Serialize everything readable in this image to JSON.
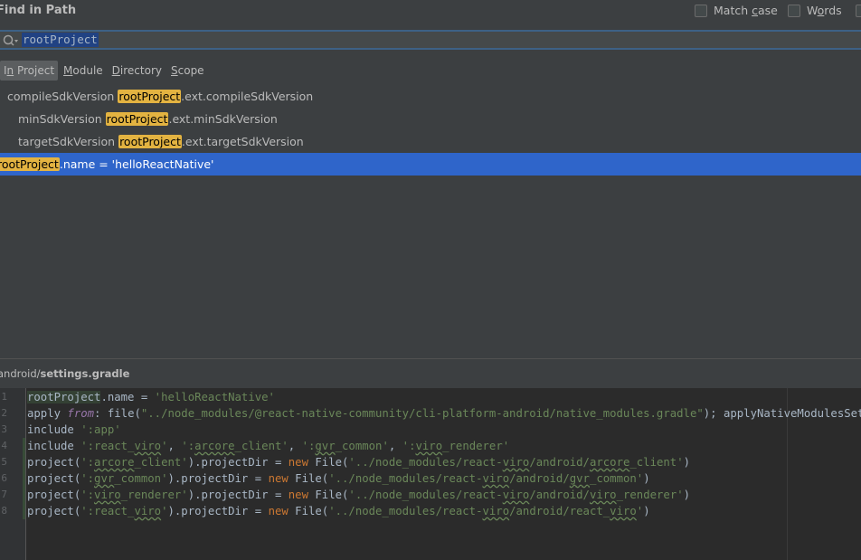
{
  "header": {
    "title": "Find in Path",
    "match_case_label": "Match case",
    "words_label": "Words"
  },
  "search": {
    "value": "rootProject"
  },
  "scopes": [
    "In Project",
    "Module",
    "Directory",
    "Scope"
  ],
  "results": [
    {
      "before": "compileSdkVersion ",
      "match": "rootProject",
      "after": ".ext.compileSdkVersion"
    },
    {
      "before": "minSdkVersion ",
      "match": "rootProject",
      "after": ".ext.minSdkVersion"
    },
    {
      "before": "targetSdkVersion ",
      "match": "rootProject",
      "after": ".ext.targetSdkVersion"
    },
    {
      "before": "",
      "match": "rootProject",
      "after": ".name = 'helloReactNative'"
    }
  ],
  "file": {
    "dir": "android/",
    "name": "settings.gradle"
  },
  "editor": {
    "line_numbers": [
      "1",
      "2",
      "3",
      "4",
      "5",
      "6",
      "7",
      "8"
    ],
    "lines": [
      "rootProject.name = 'helloReactNative'",
      "apply from: file(\"../node_modules/@react-native-community/cli-platform-android/native_modules.gradle\"); applyNativeModulesSettingsGr",
      "include ':app'",
      "include ':react_viro', ':arcore_client', ':gvr_common', ':viro_renderer'",
      "project(':arcore_client').projectDir = new File('../node_modules/react-viro/android/arcore_client')",
      "project(':gvr_common').projectDir = new File('../node_modules/react-viro/android/gvr_common')",
      "project(':viro_renderer').projectDir = new File('../node_modules/react-viro/android/viro_renderer')",
      "project(':react_viro').projectDir = new File('../node_modules/react-viro/android/react_viro')"
    ]
  },
  "colors": {
    "background": "#3c3f41",
    "editor_bg": "#2b2b2b",
    "selection": "#2f65ca",
    "match_highlight": "#e3b341",
    "string": "#6a8759",
    "keyword": "#cc7832"
  }
}
